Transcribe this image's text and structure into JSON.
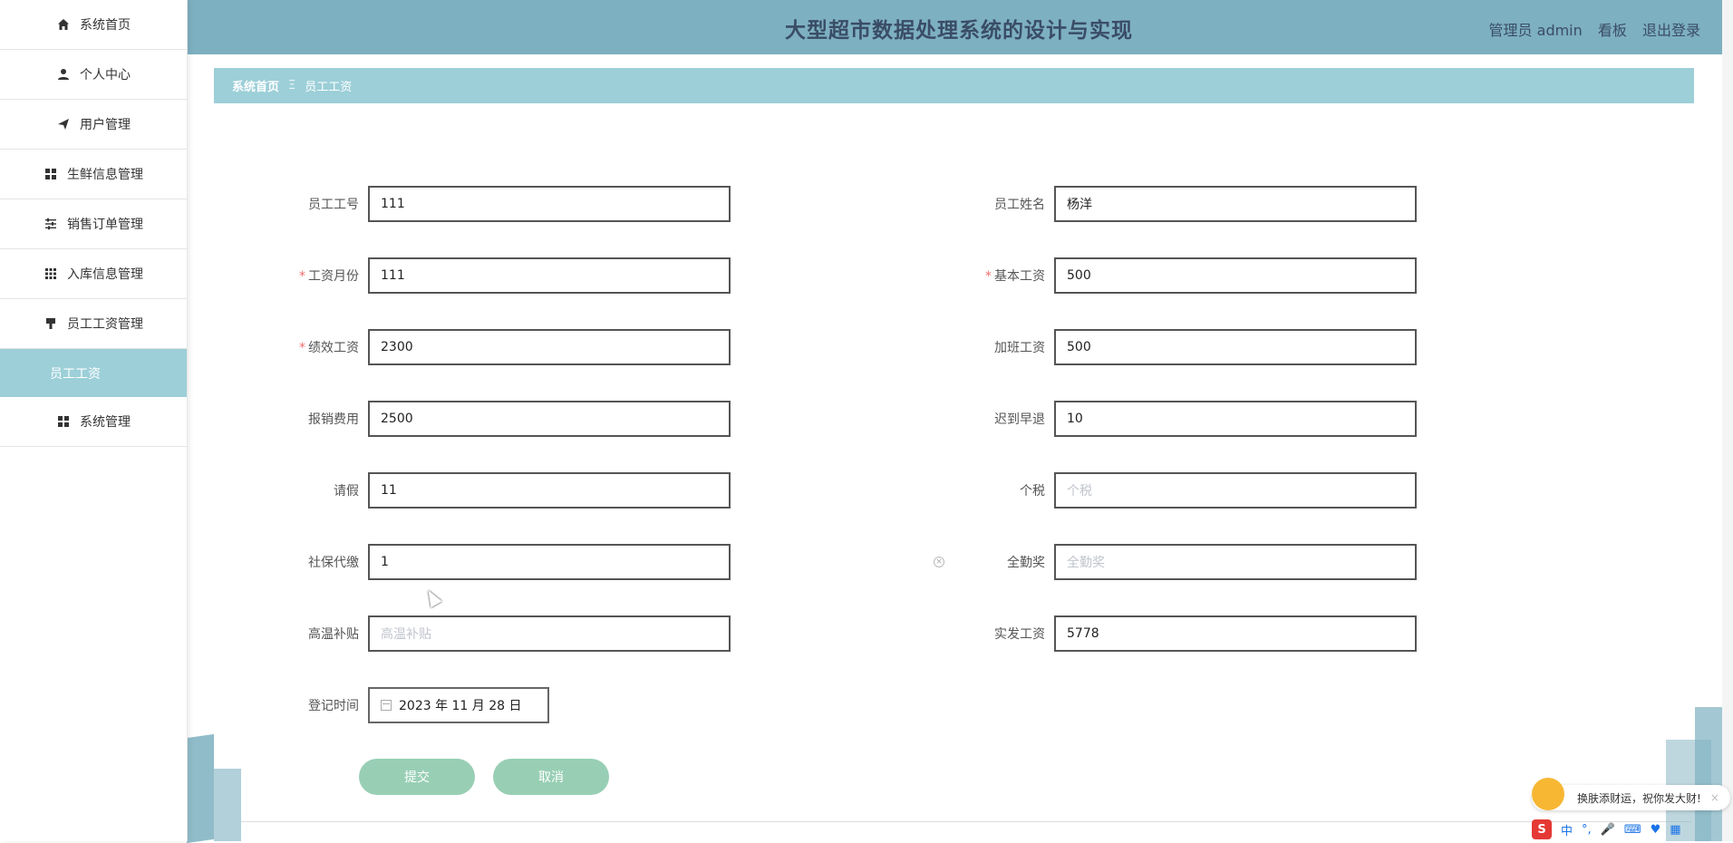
{
  "sidebar": {
    "items": [
      {
        "label": "系统首页",
        "icon": "home-icon"
      },
      {
        "label": "个人中心",
        "icon": "user-icon"
      },
      {
        "label": "用户管理",
        "icon": "send-icon"
      },
      {
        "label": "生鲜信息管理",
        "icon": "grid-icon"
      },
      {
        "label": "销售订单管理",
        "icon": "sliders-icon"
      },
      {
        "label": "入库信息管理",
        "icon": "apps-icon"
      },
      {
        "label": "员工工资管理",
        "icon": "brush-icon"
      }
    ],
    "active_sub": "员工工资",
    "last_item": {
      "label": "系统管理",
      "icon": "grid-icon"
    }
  },
  "header": {
    "title": "大型超市数据处理系统的设计与实现",
    "role_user": "管理员 admin",
    "board": "看板",
    "logout": "退出登录"
  },
  "breadcrumb": {
    "home": "系统首页",
    "separator": "Ξ",
    "current": "员工工资"
  },
  "form": {
    "fields": {
      "emp_no": {
        "label": "员工工号",
        "value": "111",
        "required": false
      },
      "emp_name": {
        "label": "员工姓名",
        "value": "杨洋",
        "required": false
      },
      "month": {
        "label": "工资月份",
        "value": "111",
        "required": true
      },
      "base": {
        "label": "基本工资",
        "value": "500",
        "required": true
      },
      "perf": {
        "label": "绩效工资",
        "value": "2300",
        "required": true
      },
      "overtime": {
        "label": "加班工资",
        "value": "500",
        "required": false
      },
      "reimburse": {
        "label": "报销费用",
        "value": "2500",
        "required": false
      },
      "late": {
        "label": "迟到早退",
        "value": "10",
        "required": false
      },
      "leave": {
        "label": "请假",
        "value": "11",
        "required": false
      },
      "tax": {
        "label": "个税",
        "value": "",
        "placeholder": "个税",
        "required": false
      },
      "social": {
        "label": "社保代缴",
        "value": "1",
        "required": false
      },
      "attendance": {
        "label": "全勤奖",
        "value": "",
        "placeholder": "全勤奖",
        "required": false
      },
      "heat": {
        "label": "高温补贴",
        "value": "",
        "placeholder": "高温补贴",
        "required": false
      },
      "actual": {
        "label": "实发工资",
        "value": "5778",
        "required": false
      },
      "reg_time": {
        "label": "登记时间",
        "value": "2023 年 11 月 28 日",
        "required": false
      }
    },
    "submit": "提交",
    "cancel": "取消"
  },
  "ime": {
    "tip": "换肤添财运，祝你发大财!",
    "lang": "中",
    "logo": "S"
  },
  "colors": {
    "header": "#7db0c0",
    "breadcrumb": "#9ccfd8",
    "button": "#98cfb4",
    "required": "#f56c6c"
  }
}
